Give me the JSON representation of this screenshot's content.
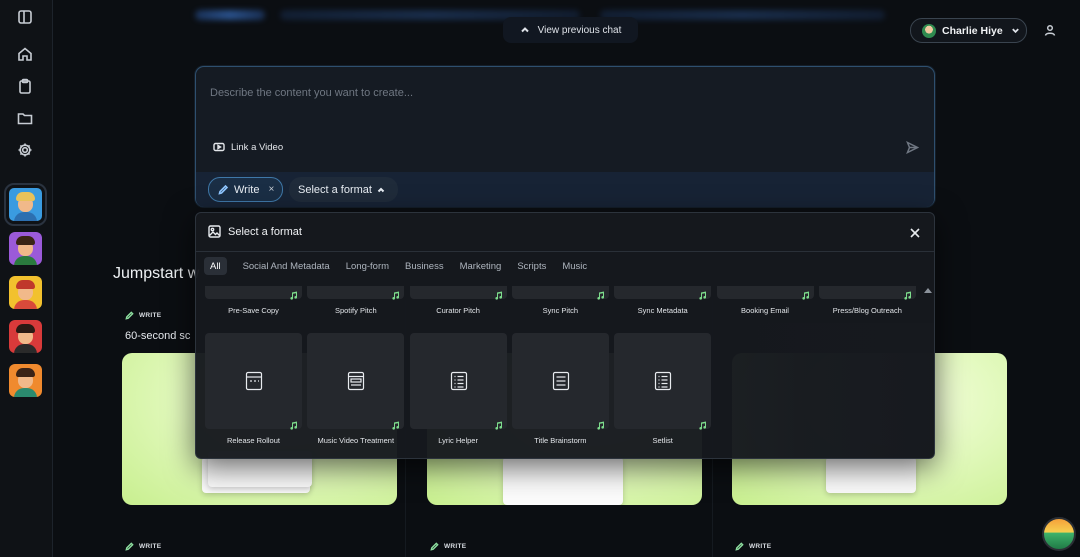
{
  "top": {
    "view_previous_chat": "View previous chat",
    "user_name": "Charlie Hiye"
  },
  "sidebar": {
    "icons": [
      "sidebar-toggle-icon",
      "home-icon",
      "clipboard-icon",
      "folder-icon",
      "gear-icon"
    ],
    "avatars": [
      {
        "hair": "#e9c25a",
        "bg": "#3a9be0",
        "body": "#2c6fb0",
        "selected": true
      },
      {
        "hair": "#3a2415",
        "bg": "#9b5ad9",
        "body": "#2a7a3e",
        "selected": false
      },
      {
        "hair": "#c0382b",
        "bg": "#f2c12e",
        "body": "#d94a3a",
        "selected": false
      },
      {
        "hair": "#2a1a14",
        "bg": "#d83a3a",
        "body": "#2a2a2a",
        "selected": false
      },
      {
        "hair": "#3b2316",
        "bg": "#f08a2e",
        "body": "#2b8a6e",
        "selected": false
      }
    ]
  },
  "composer": {
    "placeholder": "Describe the content you want to create...",
    "link_video": "Link a Video",
    "write_chip": "Write",
    "remove_chip": "×",
    "format_chip": "Select a format"
  },
  "background": {
    "jumpstart_title": "Jumpstart w",
    "card_tag": "WRITE",
    "first_card_title": "60-second sc"
  },
  "panel": {
    "title": "Select a format",
    "tabs": [
      "All",
      "Social And Metadata",
      "Long-form",
      "Business",
      "Marketing",
      "Scripts",
      "Music"
    ],
    "active_tab": "All",
    "row1_labels": [
      "Pre-Save Copy",
      "Spotify Pitch",
      "Curator Pitch",
      "Sync Pitch",
      "Sync Metadata",
      "Booking Email",
      "Press/Blog Outreach"
    ],
    "row2_tiles": [
      {
        "label": "Release Rollout",
        "icon": "calendar-doc-icon"
      },
      {
        "label": "Music Video Treatment",
        "icon": "layout-doc-icon"
      },
      {
        "label": "Lyric Helper",
        "icon": "list-doc-icon"
      },
      {
        "label": "Title Brainstorm",
        "icon": "lines-doc-icon"
      },
      {
        "label": "Setlist",
        "icon": "list-doc-icon"
      }
    ]
  },
  "colors": {
    "accent": "#3f78a8",
    "music_note": "#7ddc8c",
    "card_green": "#d4f4a2"
  }
}
